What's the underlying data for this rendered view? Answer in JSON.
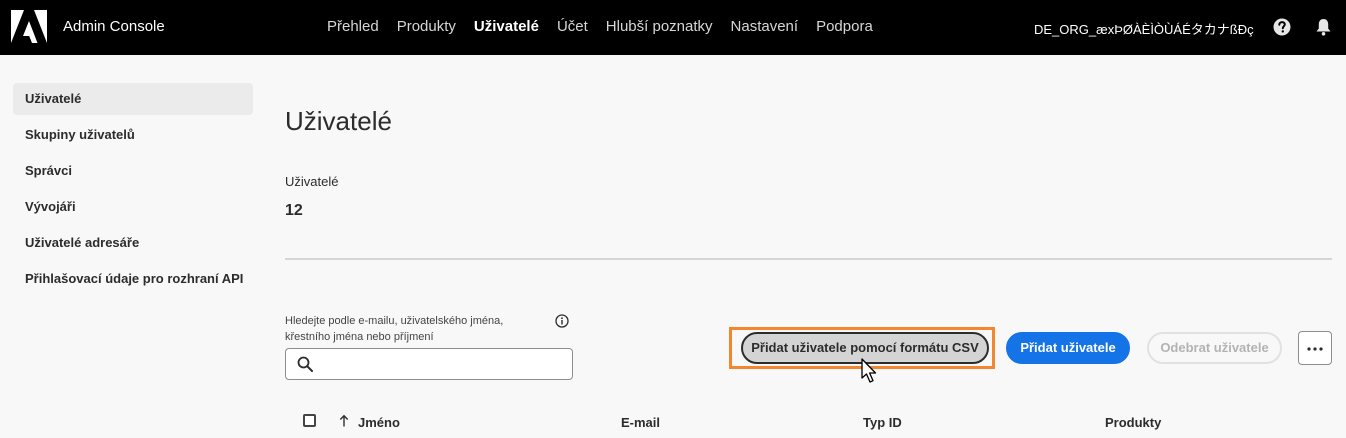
{
  "header": {
    "brand": "Admin Console",
    "nav": [
      {
        "label": "Přehled",
        "active": false
      },
      {
        "label": "Produkty",
        "active": false
      },
      {
        "label": "Uživatelé",
        "active": true
      },
      {
        "label": "Účet",
        "active": false
      },
      {
        "label": "Hlubší poznatky",
        "active": false
      },
      {
        "label": "Nastavení",
        "active": false
      },
      {
        "label": "Podpora",
        "active": false
      }
    ],
    "org_name": "DE_ORG_æxÞØÀÈÌÒÙÁÉタカナßÐç",
    "icons": [
      "adobe-logo",
      "help-icon",
      "bell-icon"
    ]
  },
  "sidebar": {
    "items": [
      {
        "label": "Uživatelé",
        "selected": true
      },
      {
        "label": "Skupiny uživatelů",
        "selected": false
      },
      {
        "label": "Správci",
        "selected": false
      },
      {
        "label": "Vývojáři",
        "selected": false
      },
      {
        "label": "Uživatelé adresáře",
        "selected": false
      },
      {
        "label": "Přihlašovací údaje pro rozhraní API",
        "selected": false
      }
    ]
  },
  "main": {
    "title": "Uživatelé",
    "count_label": "Uživatelé",
    "count_value": "12",
    "search": {
      "label": "Hledejte podle e-mailu, uživatelského jména, křestního jména nebo příjmení",
      "value": "",
      "placeholder": ""
    },
    "buttons": {
      "add_csv": "Přidat uživatele pomocí formátu CSV",
      "add_user": "Přidat uživatele",
      "remove_user": "Odebrat uživatele"
    },
    "table": {
      "columns": [
        "Jméno",
        "E-mail",
        "Typ ID",
        "Produkty"
      ]
    }
  },
  "colors": {
    "topbar": "#000000",
    "primary_button": "#1473e6",
    "highlight": "#f2872d",
    "selected_sidebar": "#ebebeb"
  }
}
